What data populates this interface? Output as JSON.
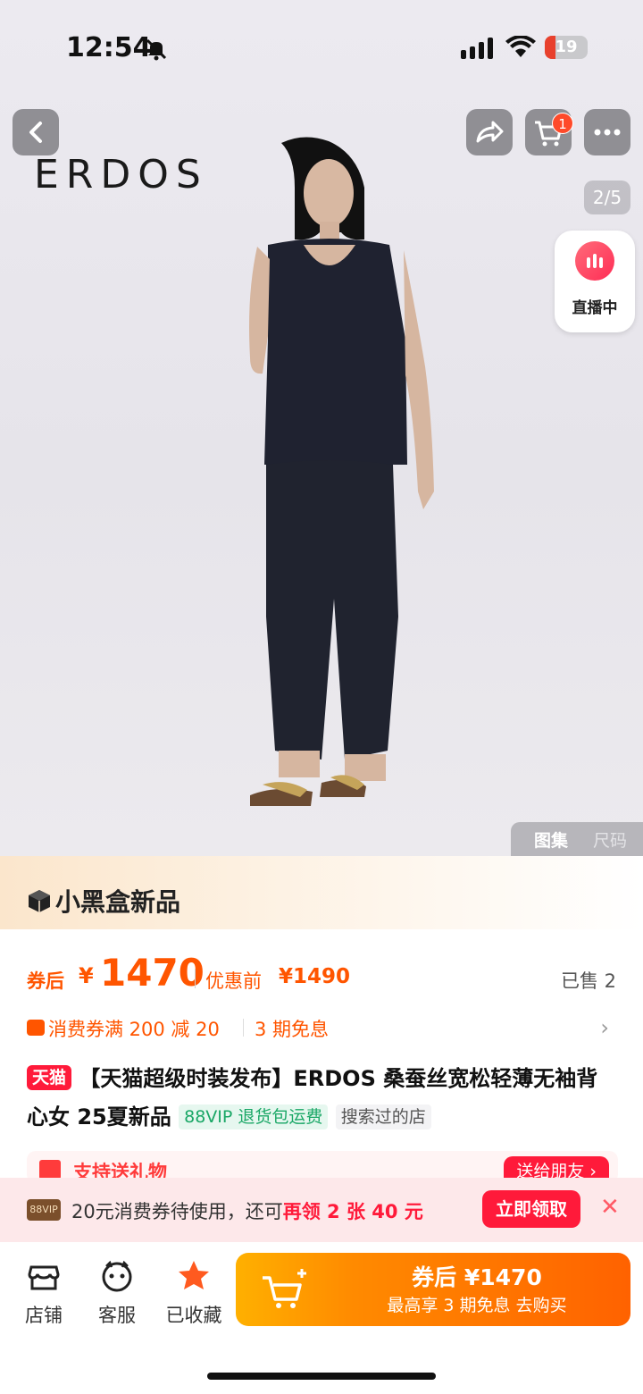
{
  "status": {
    "time": "12:54",
    "battery": "19"
  },
  "nav": {
    "cart_badge": "1",
    "image_counter": "2/5",
    "live_label": "直播中"
  },
  "hero": {
    "brand_logo": "ERDOS",
    "tabs": [
      "图集",
      "尺码"
    ]
  },
  "promo": {
    "title": "小黑盒新品"
  },
  "price": {
    "after_coupon_label": "券后",
    "currency": "¥",
    "after_coupon_value": "1470",
    "before_label": "优惠前",
    "before_value": "¥1490",
    "sold": "已售 2"
  },
  "coupon": {
    "text": "消费券满 200 减 20",
    "installment": "3 期免息"
  },
  "title": {
    "tag": "天猫",
    "text": "【天猫超级时装发布】ERDOS 桑蚕丝宽松轻薄无袖背心女 25夏新品",
    "vip_tag": "88VIP 退货包运费",
    "searched_tag": "搜索过的店"
  },
  "gift": {
    "text": "支持送礼物",
    "button": "送给朋友 ›"
  },
  "coupon_banner": {
    "badge": "88VIP",
    "text_prefix": "20元消费券待使用，还可",
    "text_highlight": "再领 2 张 40 元",
    "button": "立即领取"
  },
  "bottom": {
    "shop": "店铺",
    "service": "客服",
    "favorite": "已收藏",
    "buy_main": "券后 ¥1470",
    "buy_sub": "最高享 3 期免息  去购买"
  },
  "colors": {
    "accent": "#ff5500",
    "tmall_red": "#ff1a3a",
    "vip_green": "#1aa766"
  }
}
